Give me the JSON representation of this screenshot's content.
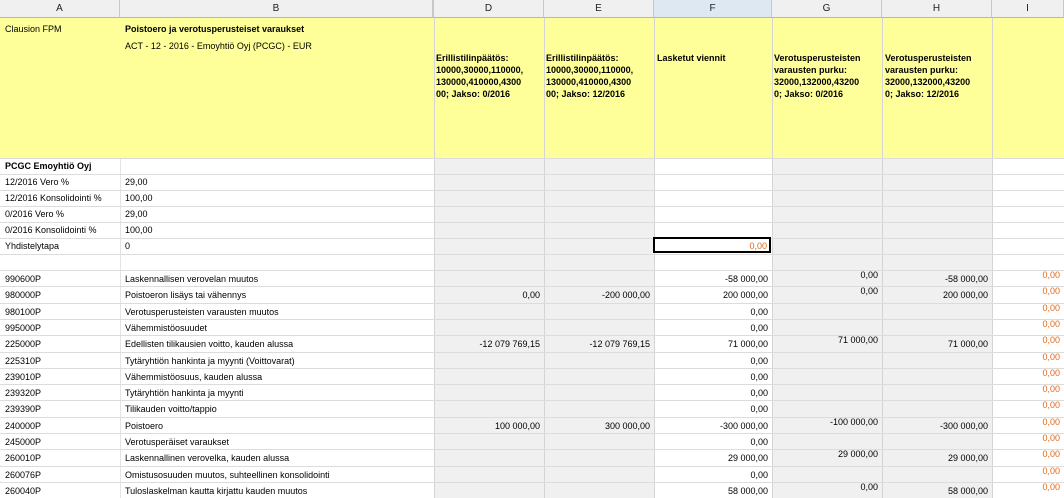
{
  "columns": [
    "A",
    "B",
    "",
    "D",
    "E",
    "F",
    "G",
    "H",
    "I"
  ],
  "header": {
    "a_label": "Clausion FPM",
    "title": "Poistoero ja verotusperusteiset varaukset",
    "subtitle": "ACT - 12 - 2016 - Emoyhtiö Oyj (PCGC) - EUR",
    "col_d": "Erillistilinpäätös:\n10000,30000,110000,\n130000,410000,4300\n00; Jakso: 0/2016",
    "col_e": "Erillistilinpäätös:\n10000,30000,110000,\n130000,410000,4300\n00; Jakso: 12/2016",
    "col_f": "Lasketut viennit",
    "col_g": "Verotusperusteisten\nvarausten purku:\n32000,132000,43200\n0; Jakso: 0/2016",
    "col_h": "Verotusperusteisten\nvarausten purku:\n32000,132000,43200\n0; Jakso: 12/2016"
  },
  "company": "PCGC Emoyhtiö Oyj",
  "params": [
    {
      "label": "12/2016 Vero %",
      "value": "29,00"
    },
    {
      "label": "12/2016 Konsolidointi %",
      "value": "100,00"
    },
    {
      "label": "0/2016 Vero %",
      "value": "29,00"
    },
    {
      "label": "0/2016 Konsolidointi %",
      "value": "100,00"
    },
    {
      "label": "Yhdistelytapa",
      "value": "0"
    }
  ],
  "active_cell_value": "0,00",
  "rows": [
    {
      "code": "990600P",
      "name": "Laskennallisen verovelan muutos",
      "d": "",
      "e": "",
      "f": "-58 000,00",
      "g": "0,00",
      "h": "-58 000,00",
      "i": "0,00"
    },
    {
      "code": "980000P",
      "name": "Poistoeron lisäys tai vähennys",
      "d": "0,00",
      "e": "-200 000,00",
      "f": "200 000,00",
      "g": "0,00",
      "h": "200 000,00",
      "i": "0,00"
    },
    {
      "code": "980100P",
      "name": "Verotusperusteisten varausten muutos",
      "d": "",
      "e": "",
      "f": "0,00",
      "g": "",
      "h": "",
      "i": "0,00"
    },
    {
      "code": "995000P",
      "name": "Vähemmistöosuudet",
      "d": "",
      "e": "",
      "f": "0,00",
      "g": "",
      "h": "",
      "i": "0,00"
    },
    {
      "code": "225000P",
      "name": "Edellisten tilikausien voitto, kauden alussa",
      "d": "-12 079 769,15",
      "e": "-12 079 769,15",
      "f": "71 000,00",
      "g": "71 000,00",
      "h": "71 000,00",
      "i": "0,00"
    },
    {
      "code": "225310P",
      "name": "Tytäryhtiön hankinta ja myynti (Voittovarat)",
      "d": "",
      "e": "",
      "f": "0,00",
      "g": "",
      "h": "",
      "i": "0,00"
    },
    {
      "code": "239010P",
      "name": "Vähemmistöosuus, kauden alussa",
      "d": "",
      "e": "",
      "f": "0,00",
      "g": "",
      "h": "",
      "i": "0,00"
    },
    {
      "code": "239320P",
      "name": "Tytäryhtiön hankinta ja myynti",
      "d": "",
      "e": "",
      "f": "0,00",
      "g": "",
      "h": "",
      "i": "0,00"
    },
    {
      "code": "239390P",
      "name": "Tilikauden voitto/tappio",
      "d": "",
      "e": "",
      "f": "0,00",
      "g": "",
      "h": "",
      "i": "0,00"
    },
    {
      "code": "240000P",
      "name": "Poistoero",
      "d": "100 000,00",
      "e": "300 000,00",
      "f": "-300 000,00",
      "g": "-100 000,00",
      "h": "-300 000,00",
      "i": "0,00"
    },
    {
      "code": "245000P",
      "name": "Verotusperäiset varaukset",
      "d": "",
      "e": "",
      "f": "0,00",
      "g": "",
      "h": "",
      "i": "0,00"
    },
    {
      "code": "260010P",
      "name": "Laskennallinen verovelka, kauden alussa",
      "d": "",
      "e": "",
      "f": "29 000,00",
      "g": "29 000,00",
      "h": "29 000,00",
      "i": "0,00"
    },
    {
      "code": "260076P",
      "name": "Omistusosuuden muutos, suhteellinen konsolidointi",
      "d": "",
      "e": "",
      "f": "0,00",
      "g": "",
      "h": "",
      "i": "0,00"
    },
    {
      "code": "260040P",
      "name": "Tuloslaskelman kautta kirjattu kauden muutos",
      "d": "",
      "e": "",
      "f": "58 000,00",
      "g": "0,00",
      "h": "58 000,00",
      "i": "0,00"
    }
  ]
}
